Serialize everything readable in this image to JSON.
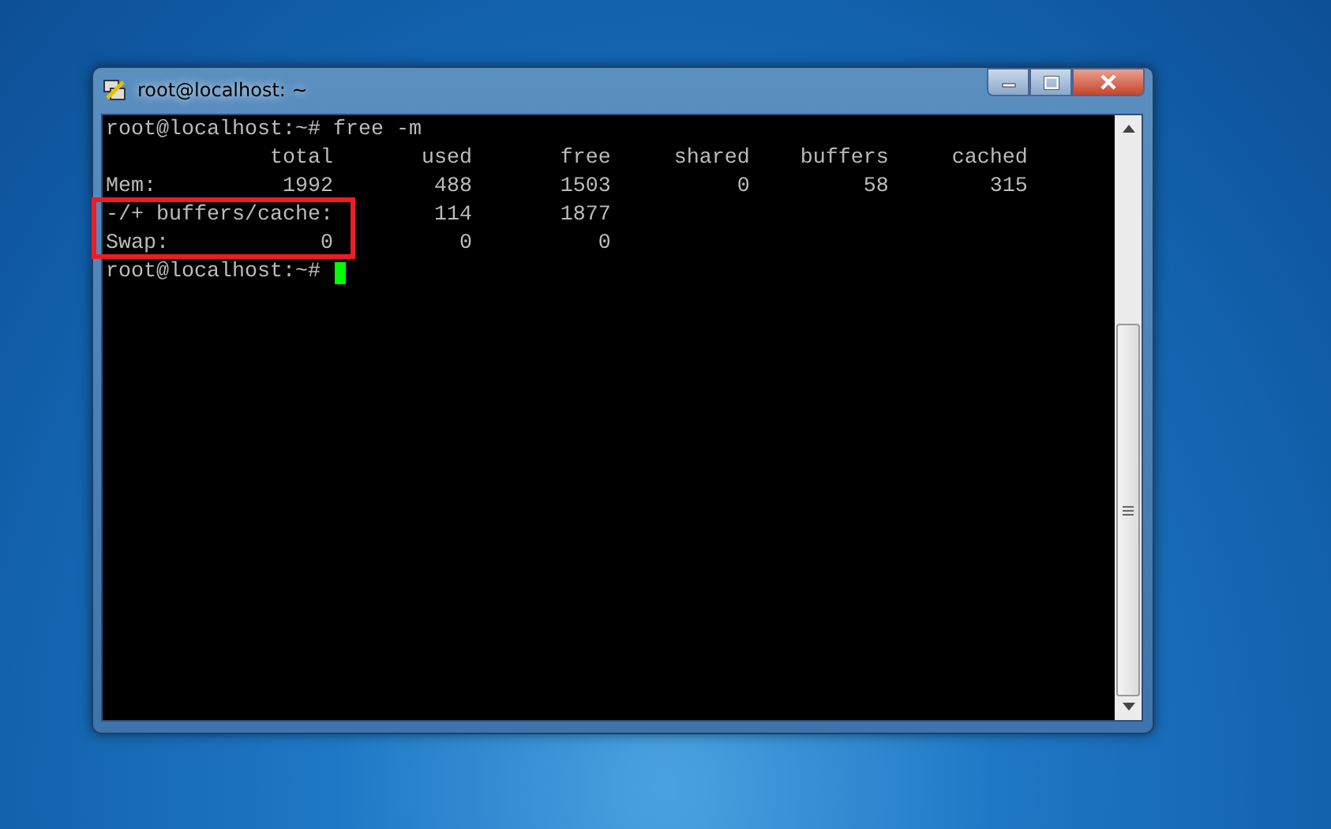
{
  "window": {
    "title": "root@localhost: ~"
  },
  "terminal": {
    "lines": [
      "root@localhost:~# free -m",
      "             total       used       free     shared    buffers     cached",
      "Mem:          1992        488       1503          0         58        315",
      "-/+ buffers/cache:        114       1877",
      "Swap:            0          0          0"
    ],
    "prompt": "root@localhost:~#"
  }
}
